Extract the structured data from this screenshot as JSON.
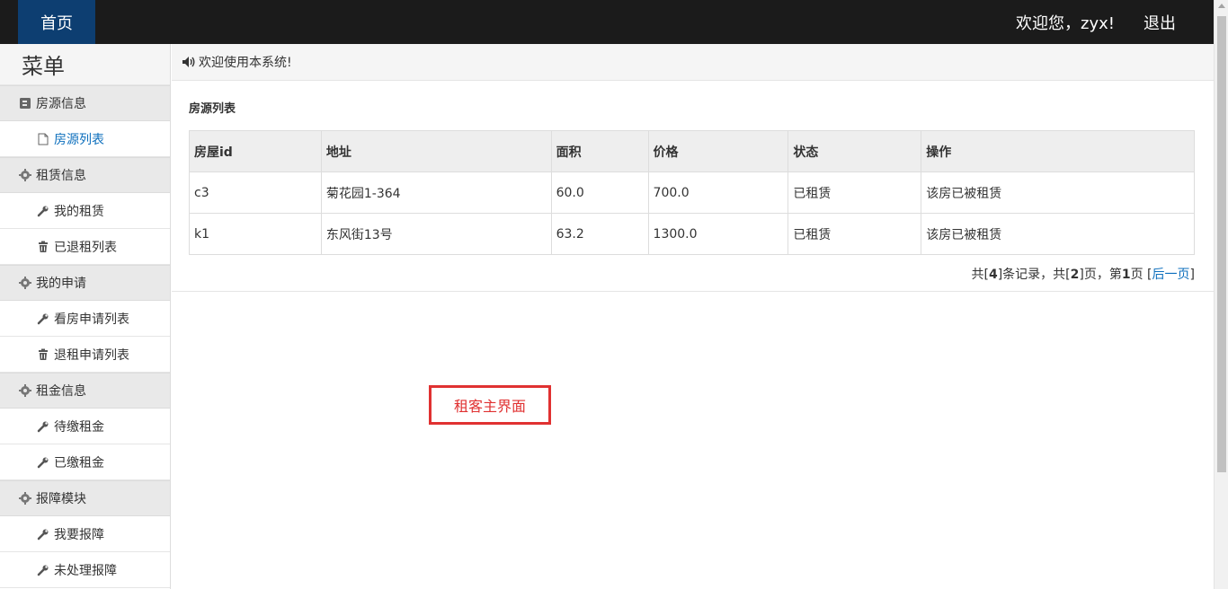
{
  "topbar": {
    "home_label": "首页",
    "welcome_text": "欢迎您，zyx!",
    "logout_label": "退出"
  },
  "sidebar": {
    "title": "菜单",
    "groups": [
      {
        "label": "房源信息",
        "icon": "book-icon",
        "items": [
          {
            "label": "房源列表",
            "icon": "file-icon"
          }
        ]
      },
      {
        "label": "租赁信息",
        "icon": "gear-icon",
        "items": [
          {
            "label": "我的租赁",
            "icon": "wrench-icon"
          },
          {
            "label": "已退租列表",
            "icon": "trash-icon"
          }
        ]
      },
      {
        "label": "我的申请",
        "icon": "gear-icon",
        "items": [
          {
            "label": "看房申请列表",
            "icon": "wrench-icon"
          },
          {
            "label": "退租申请列表",
            "icon": "trash-icon"
          }
        ]
      },
      {
        "label": "租金信息",
        "icon": "gear-icon",
        "items": [
          {
            "label": "待缴租金",
            "icon": "wrench-icon"
          },
          {
            "label": "已缴租金",
            "icon": "wrench-icon"
          }
        ]
      },
      {
        "label": "报障模块",
        "icon": "gear-icon",
        "items": [
          {
            "label": "我要报障",
            "icon": "wrench-icon"
          },
          {
            "label": "未处理报障",
            "icon": "wrench-icon"
          }
        ]
      }
    ]
  },
  "notice": {
    "icon": "speaker-icon",
    "text": "欢迎使用本系统!"
  },
  "panel": {
    "title": "房源列表",
    "columns": [
      "房屋id",
      "地址",
      "面积",
      "价格",
      "状态",
      "操作"
    ],
    "rows": [
      [
        "c3",
        "菊花园1-364",
        "60.0",
        "700.0",
        "已租赁",
        "该房已被租赁"
      ],
      [
        "k1",
        "东风街13号",
        "63.2",
        "1300.0",
        "已租赁",
        "该房已被租赁"
      ]
    ],
    "pager": {
      "prefix": "共[",
      "records": "4",
      "mid1": "]条记录，共[",
      "pages": "2",
      "mid2": "]页，第",
      "current": "1",
      "mid3": "页 [",
      "next_label": "后一页",
      "suffix": "]"
    }
  },
  "annotation": {
    "label": "租客主界面",
    "color": "#e03131"
  }
}
